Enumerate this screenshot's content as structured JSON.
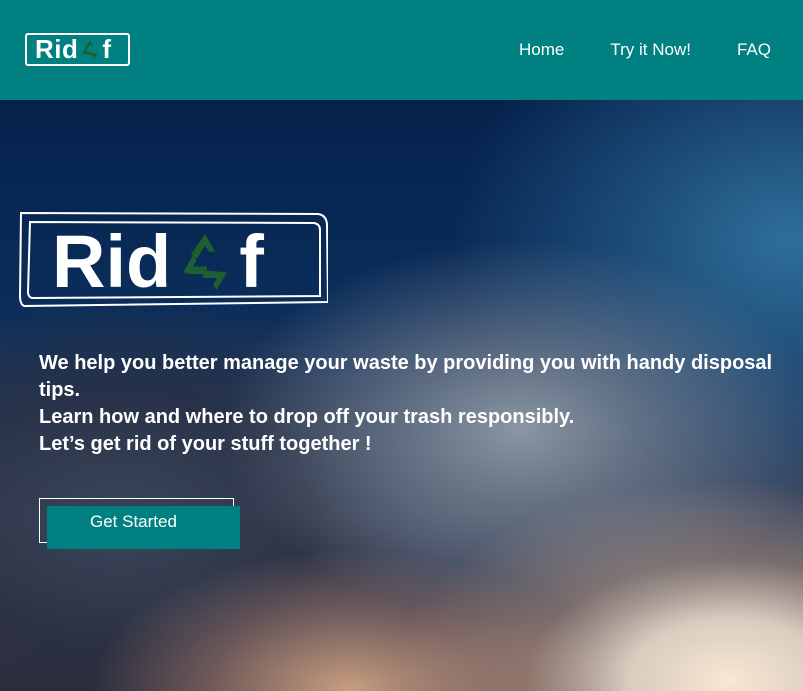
{
  "header": {
    "logo_text_left": "Rid",
    "logo_text_right": "f",
    "logo_icon": "recycle-icon",
    "nav": [
      {
        "label": "Home"
      },
      {
        "label": "Try it Now!"
      },
      {
        "label": "FAQ"
      }
    ]
  },
  "hero": {
    "logo_text_left": "Rid",
    "logo_text_right": "f",
    "logo_icon": "recycle-icon",
    "tagline": [
      "We help you better manage your waste by providing you with handy disposal tips.",
      "Learn how and where to drop off your trash responsibly.",
      "Let’s get rid of your stuff together !"
    ],
    "cta_label": "Get Started"
  },
  "colors": {
    "header_bg": "#008080",
    "recycle_green": "#1e5e30",
    "text": "#ffffff"
  }
}
